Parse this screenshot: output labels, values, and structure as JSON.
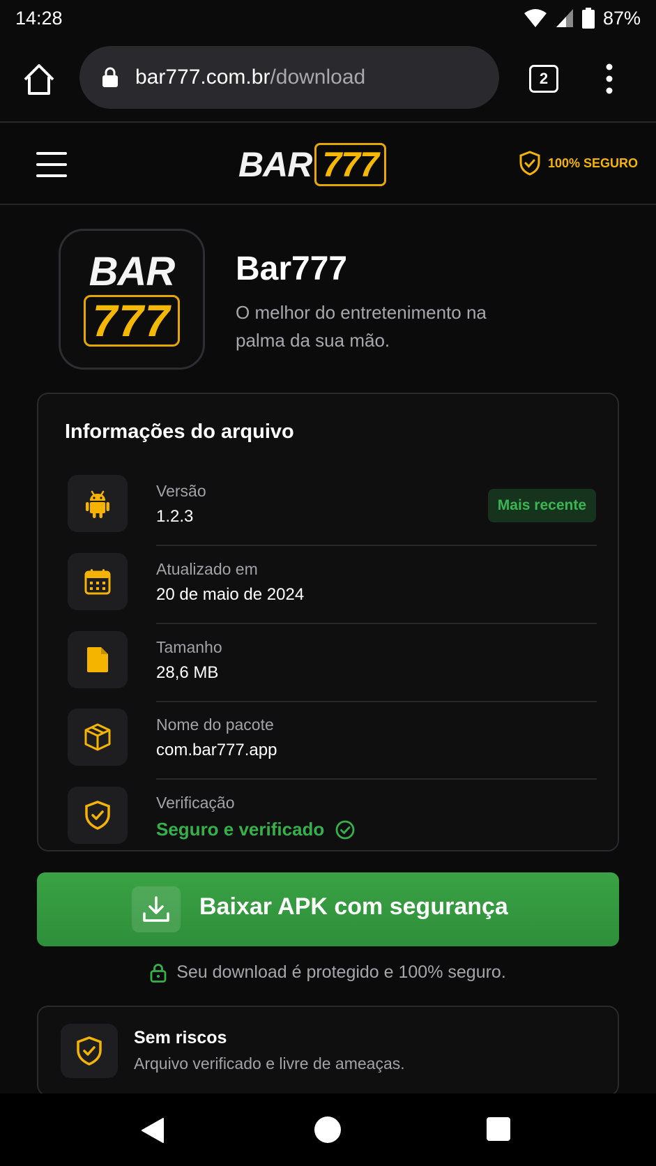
{
  "status_bar": {
    "time": "14:28",
    "battery": "87%"
  },
  "browser": {
    "url_host": "bar777.com.br",
    "url_path": "/download",
    "tab_count": "2"
  },
  "header": {
    "logo_bar": "BAR",
    "logo_777": "777",
    "secure_label": "100% SEGURO"
  },
  "app": {
    "icon_bar": "BAR",
    "icon_777": "777",
    "name": "Bar777",
    "tagline": "O melhor do entretenimento na palma da sua mão."
  },
  "file_info": {
    "title": "Informações do arquivo",
    "rows": [
      {
        "label": "Versão",
        "value": "1.2.3",
        "icon": "android-icon",
        "badge": "Mais recente"
      },
      {
        "label": "Atualizado em",
        "value": "20 de maio de 2024",
        "icon": "calendar-icon"
      },
      {
        "label": "Tamanho",
        "value": "28,6 MB",
        "icon": "file-icon"
      },
      {
        "label": "Nome do pacote",
        "value": "com.bar777.app",
        "icon": "package-icon"
      },
      {
        "label": "Verificação",
        "value": "Seguro e verificado",
        "icon": "shield-check-icon"
      }
    ]
  },
  "download": {
    "button_label": "Baixar APK com segurança",
    "secure_note": "Seu download é protegido e 100% seguro."
  },
  "risk_card": {
    "title": "Sem riscos",
    "subtitle": "Arquivo verificado e livre de ameaças."
  },
  "colors": {
    "accent_gold": "#f5b800",
    "success_green": "#35b04a",
    "button_green": "#34993f",
    "background": "#0b0b0c"
  }
}
